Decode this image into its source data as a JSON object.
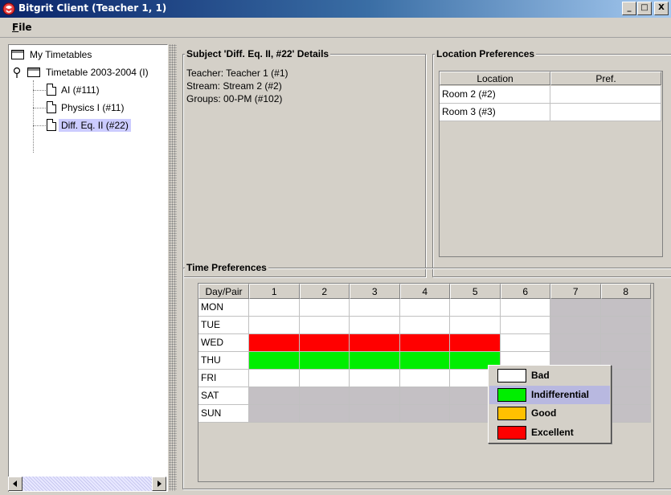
{
  "window": {
    "title": "Bitgrit Client (Teacher 1, 1)",
    "minimize_glyph": "_",
    "maximize_glyph": "□",
    "close_glyph": "X"
  },
  "menu": {
    "file_mnemonic": "F",
    "file_rest": "ile"
  },
  "tree": {
    "root": "My Timetables",
    "timetable": "Timetable 2003-2004 (I)",
    "subjects": [
      "AI (#111)",
      "Physics I (#11)",
      "Diff. Eq. II (#22)"
    ],
    "selected_index": 2
  },
  "details": {
    "title": "Subject 'Diff. Eq. II, #22' Details",
    "teacher": "Teacher: Teacher 1 (#1)",
    "stream": "Stream: Stream 2 (#2)",
    "groups": "Groups: 00-PM (#102)"
  },
  "location": {
    "title": "Location Preferences",
    "headers": [
      "Location",
      "Pref."
    ],
    "rows": [
      {
        "location": "Room 2 (#2)",
        "pref": ""
      },
      {
        "location": "Room 3 (#3)",
        "pref": ""
      }
    ]
  },
  "time": {
    "title": "Time Preferences",
    "header_day": "Day/Pair",
    "pairs": [
      "1",
      "2",
      "3",
      "4",
      "5",
      "6",
      "7",
      "8"
    ],
    "days": [
      "MON",
      "TUE",
      "WED",
      "THU",
      "FRI",
      "SAT",
      "SUN"
    ],
    "grid": [
      [
        "white",
        "white",
        "white",
        "white",
        "white",
        "white",
        "gray",
        "gray"
      ],
      [
        "white",
        "white",
        "white",
        "white",
        "white",
        "white",
        "gray",
        "gray"
      ],
      [
        "red",
        "red",
        "red",
        "red",
        "red",
        "white",
        "gray",
        "gray"
      ],
      [
        "green",
        "green",
        "green",
        "green",
        "green",
        "white",
        "gray",
        "gray"
      ],
      [
        "white",
        "white",
        "white",
        "white",
        "white",
        "white",
        "gray",
        "gray"
      ],
      [
        "gray",
        "gray",
        "gray",
        "gray",
        "gray",
        "gray",
        "gray",
        "gray"
      ],
      [
        "gray",
        "gray",
        "gray",
        "gray",
        "gray",
        "gray",
        "gray",
        "gray"
      ]
    ],
    "colors": {
      "white": "#ffffff",
      "gray": "#c4c0c4",
      "red": "#ff0000",
      "green": "#00ee00",
      "orange": "#ffc000"
    }
  },
  "popup": {
    "items": [
      {
        "label": "Bad",
        "color": "#ffffff"
      },
      {
        "label": "Indifferential",
        "color": "#00ee00"
      },
      {
        "label": "Good",
        "color": "#ffc000"
      },
      {
        "label": "Excellent",
        "color": "#ff0000"
      }
    ],
    "highlighted_index": 1
  }
}
